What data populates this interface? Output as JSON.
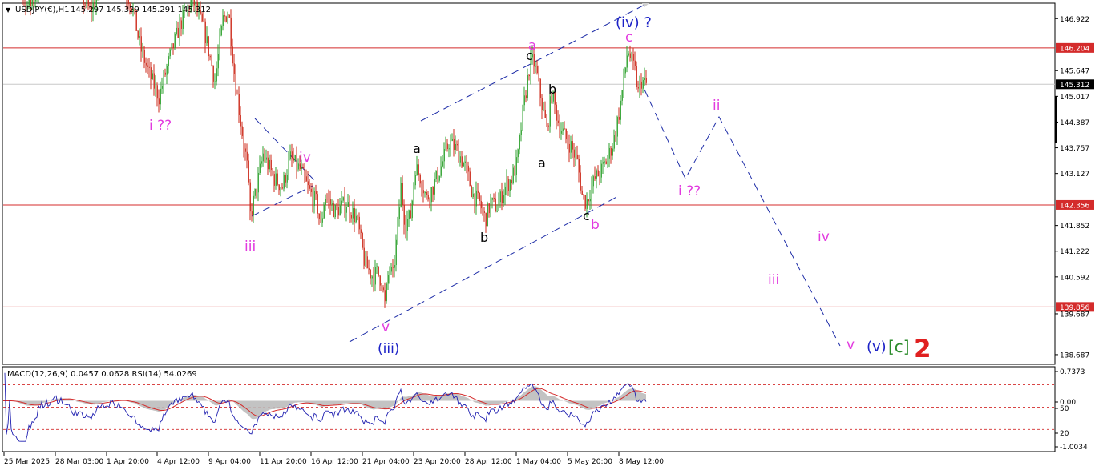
{
  "header": {
    "symbol": "USDJPY(€),H1",
    "ohlc": "145.297 145.329 145.291 145.312"
  },
  "indicator_header": "MACD(12,26,9) 0.0457 0.0628 RSI(14) 54.0269",
  "colors": {
    "bull": "#2ca02c",
    "bear": "#cc2a1a",
    "hline": "#d42b2b",
    "projection": "#1f2ea8",
    "magenta": "#e23adf",
    "blue_label": "#1c22c7",
    "green_label": "#2a8b2a",
    "red_label": "#e02020",
    "rsi": "#1f1fb0",
    "macd_signal": "#d42b2b",
    "macd_hist": "#bdbdbd"
  },
  "chart_data": [
    {
      "type": "candlestick",
      "ylim": [
        138.687,
        147.3
      ],
      "y_ticks": [
        "146.922",
        "146.204",
        "145.647",
        "145.312",
        "145.017",
        "144.387",
        "143.757",
        "143.127",
        "142.356",
        "141.852",
        "141.222",
        "140.592",
        "139.856",
        "139.687",
        "138.687"
      ],
      "x_ticks": [
        "25 Mar 2025",
        "28 Mar 03:00",
        "1 Apr 20:00",
        "4 Apr 12:00",
        "9 Apr 04:00",
        "11 Apr 20:00",
        "16 Apr 12:00",
        "21 Apr 04:00",
        "23 Apr 20:00",
        "28 Apr 12:00",
        "1 May 04:00",
        "5 May 20:00",
        "8 May 12:00"
      ],
      "horizontal_lines": [
        {
          "price": 146.204,
          "label": "146.204",
          "style": "red-tag"
        },
        {
          "price": 142.356,
          "label": "142.356",
          "style": "red-tag"
        },
        {
          "price": 139.856,
          "label": "139.856",
          "style": "red-tag"
        },
        {
          "price": 145.312,
          "label": "145.312",
          "style": "current"
        }
      ],
      "price_path": [
        [
          0,
          148.8
        ],
        [
          18,
          148.0
        ],
        [
          35,
          147.2
        ],
        [
          55,
          147.9
        ],
        [
          75,
          148.5
        ],
        [
          95,
          147.7
        ],
        [
          112,
          147.1
        ],
        [
          130,
          147.8
        ],
        [
          150,
          147.9
        ],
        [
          165,
          147.2
        ],
        [
          175,
          146.2
        ],
        [
          185,
          145.6
        ],
        [
          198,
          145.0
        ],
        [
          212,
          146.0
        ],
        [
          225,
          146.8
        ],
        [
          240,
          147.4
        ],
        [
          255,
          146.6
        ],
        [
          268,
          145.4
        ],
        [
          278,
          146.9
        ],
        [
          285,
          147.1
        ],
        [
          292,
          145.6
        ],
        [
          300,
          144.4
        ],
        [
          308,
          143.3
        ],
        [
          312,
          142.1
        ],
        [
          318,
          142.6
        ],
        [
          328,
          143.6
        ],
        [
          342,
          143.0
        ],
        [
          352,
          142.8
        ],
        [
          362,
          143.5
        ],
        [
          375,
          143.2
        ],
        [
          385,
          142.7
        ],
        [
          395,
          142.4
        ],
        [
          400,
          141.8
        ],
        [
          405,
          142.6
        ],
        [
          418,
          142.2
        ],
        [
          432,
          142.4
        ],
        [
          445,
          142.0
        ],
        [
          455,
          140.9
        ],
        [
          465,
          140.6
        ],
        [
          470,
          140.7
        ],
        [
          476,
          140.5
        ],
        [
          480,
          139.9
        ],
        [
          485,
          140.8
        ],
        [
          490,
          140.6
        ],
        [
          495,
          141.6
        ],
        [
          500,
          142.8
        ],
        [
          505,
          141.9
        ],
        [
          512,
          142.1
        ],
        [
          518,
          143.3
        ],
        [
          525,
          143.0
        ],
        [
          532,
          142.5
        ],
        [
          540,
          142.8
        ],
        [
          550,
          143.3
        ],
        [
          560,
          143.9
        ],
        [
          570,
          143.7
        ],
        [
          580,
          143.3
        ],
        [
          590,
          142.6
        ],
        [
          598,
          142.4
        ],
        [
          605,
          142.0
        ],
        [
          612,
          142.4
        ],
        [
          620,
          142.3
        ],
        [
          630,
          142.8
        ],
        [
          638,
          143.0
        ],
        [
          645,
          143.4
        ],
        [
          652,
          144.6
        ],
        [
          660,
          145.7
        ],
        [
          665,
          145.9
        ],
        [
          670,
          145.5
        ],
        [
          676,
          144.8
        ],
        [
          682,
          144.2
        ],
        [
          688,
          145.1
        ],
        [
          696,
          144.4
        ],
        [
          705,
          144.0
        ],
        [
          712,
          143.8
        ],
        [
          720,
          143.4
        ],
        [
          726,
          142.6
        ],
        [
          731,
          142.4
        ],
        [
          736,
          142.7
        ],
        [
          742,
          143.0
        ],
        [
          750,
          143.2
        ],
        [
          758,
          143.5
        ],
        [
          765,
          143.9
        ],
        [
          772,
          144.6
        ],
        [
          778,
          145.4
        ],
        [
          783,
          146.2
        ],
        [
          787,
          145.9
        ],
        [
          792,
          145.6
        ],
        [
          796,
          145.1
        ],
        [
          800,
          145.4
        ],
        [
          806,
          145.3
        ]
      ]
    },
    {
      "type": "line",
      "name": "RSI(14)",
      "ylim": [
        0,
        100
      ],
      "levels": [
        80,
        50,
        20
      ],
      "y_ticks": [
        "0.7373",
        "0.00",
        "50",
        "20",
        "-1.0034"
      ]
    }
  ],
  "wave_labels": {
    "i_qq_left": "i ??",
    "iii_left": "iii",
    "iv_left": "iv",
    "v_low": "v",
    "iii_blue": "(iii)",
    "a1": "a",
    "b1": "b",
    "c1": "c",
    "a_mag": "a",
    "b2": "b",
    "a2": "a",
    "c2": "c",
    "b_mag": "b",
    "c_mag": "c",
    "iv_blue": "(iv) ?",
    "i_qq_right": "i ??",
    "ii": "ii",
    "iii_right": "iii",
    "iv_right": "iv",
    "v_right": "v",
    "v_blue": "(v)",
    "c_green": "[c]",
    "two_red": "2"
  }
}
